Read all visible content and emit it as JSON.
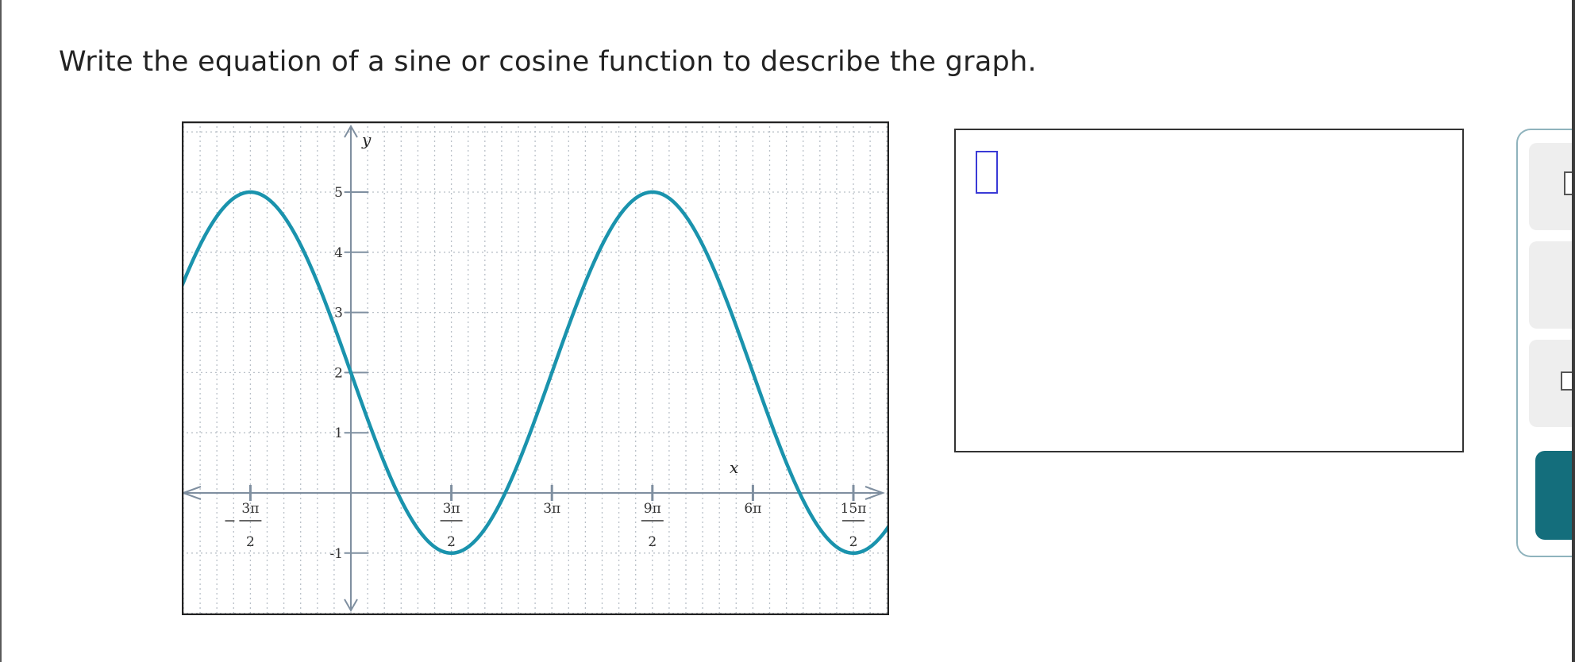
{
  "question": {
    "text": "Write the equation of a sine or cosine function to describe the graph."
  },
  "chart_data": {
    "type": "line",
    "function": "y = 3cos(x/3 + π/2) + 2",
    "xlabel": "x",
    "ylabel": "y",
    "xlim": [
      -5.34,
      16.39
    ],
    "ylim": [
      -1.95,
      5.95
    ],
    "grid": true,
    "curve_color": "#1a93ad",
    "y_ticks": [
      {
        "value": 5,
        "label": "5"
      },
      {
        "value": 4,
        "label": "4"
      },
      {
        "value": 3,
        "label": "3"
      },
      {
        "value": 2,
        "label": "2"
      },
      {
        "value": 1,
        "label": "1"
      },
      {
        "value": -1,
        "label": "-1"
      }
    ],
    "x_ticks": [
      {
        "value": -4.712,
        "num": "3π",
        "den": "2",
        "sign": "−"
      },
      {
        "value": 4.712,
        "num": "3π",
        "den": "2",
        "sign": ""
      },
      {
        "value": 9.425,
        "num": "3π",
        "den": "",
        "sign": ""
      },
      {
        "value": 14.137,
        "num": "9π",
        "den": "2",
        "sign": ""
      },
      {
        "value": 18.85,
        "num": "6π",
        "den": "",
        "sign": ""
      },
      {
        "value": 23.562,
        "num": "15π",
        "den": "2",
        "sign": ""
      }
    ],
    "series": [
      {
        "x": [
          -5.34,
          -4.712,
          0,
          4.712,
          9.425,
          14.137,
          18.85,
          23.562,
          24.67
        ],
        "y": [
          3.57,
          5,
          2,
          -1,
          2,
          5,
          2,
          -1,
          -0.87
        ]
      }
    ]
  },
  "answer": {
    "slot_hint": "equation entry"
  },
  "side_panel": {
    "tools": [
      "exponent-tool",
      "fraction-tool",
      "subscript-tool"
    ],
    "action_color": "#146e7c"
  }
}
